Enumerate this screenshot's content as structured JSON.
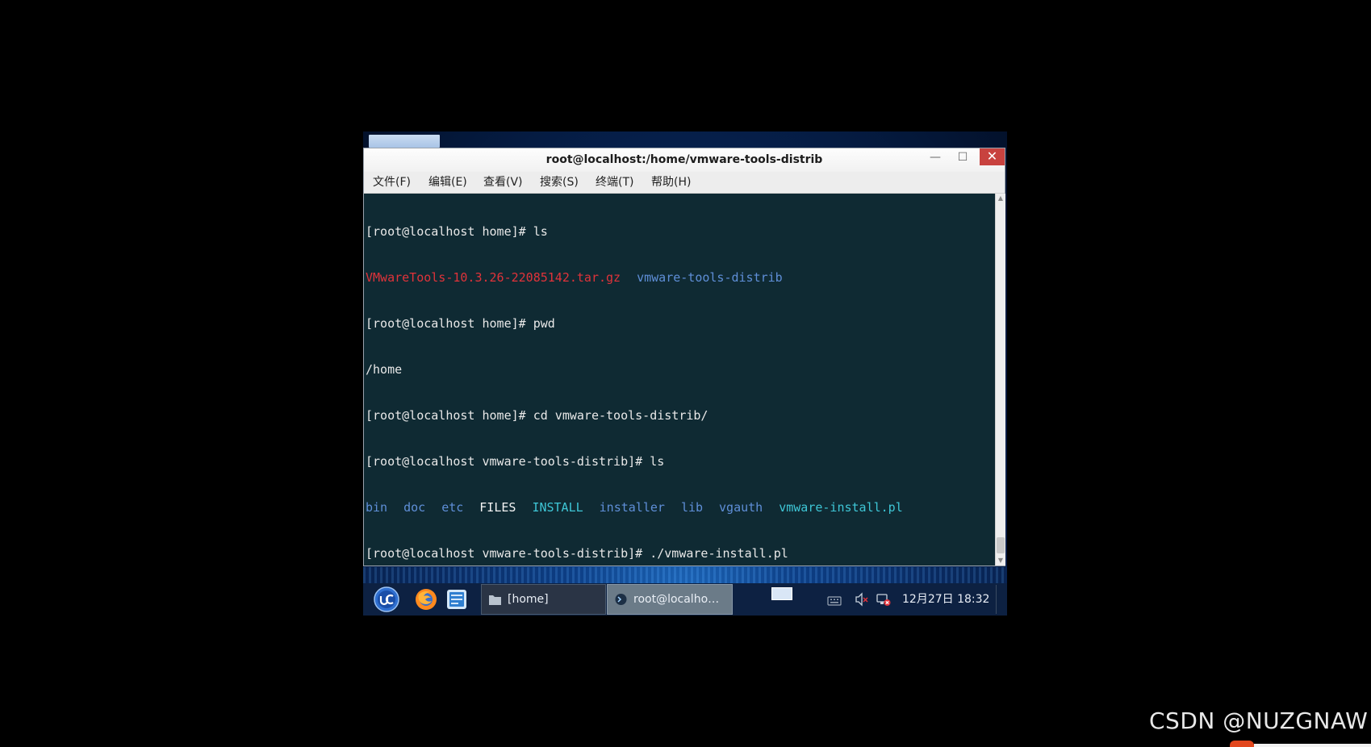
{
  "window": {
    "title": "root@localhost:/home/vmware-tools-distrib",
    "minimize_glyph": "—",
    "maximize_glyph": "☐",
    "close_glyph": "✕"
  },
  "menu": {
    "file": "文件(F)",
    "edit": "编辑(E)",
    "view": "查看(V)",
    "search": "搜索(S)",
    "terminal": "终端(T)",
    "help": "帮助(H)"
  },
  "terminal": {
    "prompt_home": "[root@localhost home]# ",
    "prompt_distrib": "[root@localhost vmware-tools-distrib]# ",
    "cmd_ls": "ls",
    "cmd_pwd": "pwd",
    "cmd_cd": "cd vmware-tools-distrib/",
    "cmd_install": "./vmware-install.pl",
    "ls_home": {
      "archive": "VMwareTools-10.3.26-22085142.tar.gz",
      "dir": "vmware-tools-distrib"
    },
    "pwd_output": "/home",
    "ls_distrib": {
      "bin": "bin",
      "doc": "doc",
      "etc": "etc",
      "files": "FILES",
      "install": "INSTALL",
      "installer": "installer",
      "lib": "lib",
      "vgauth": "vgauth",
      "script": "vmware-install.pl"
    },
    "colors": {
      "background": "#0f2a33",
      "text": "#e8e8e8",
      "archive": "#e0333a",
      "directory": "#5f8fd8",
      "executable": "#3ec6d6"
    }
  },
  "taskbar": {
    "start_icon": "start-menu-icon",
    "firefox_icon": "firefox-icon",
    "filemanager_icon": "file-manager-icon",
    "task_home_label": "[home]",
    "task_terminal_label": "root@localho…",
    "clock": "12月27日 18:32"
  },
  "watermark": {
    "text": "CSDN @NUZGNAW"
  }
}
